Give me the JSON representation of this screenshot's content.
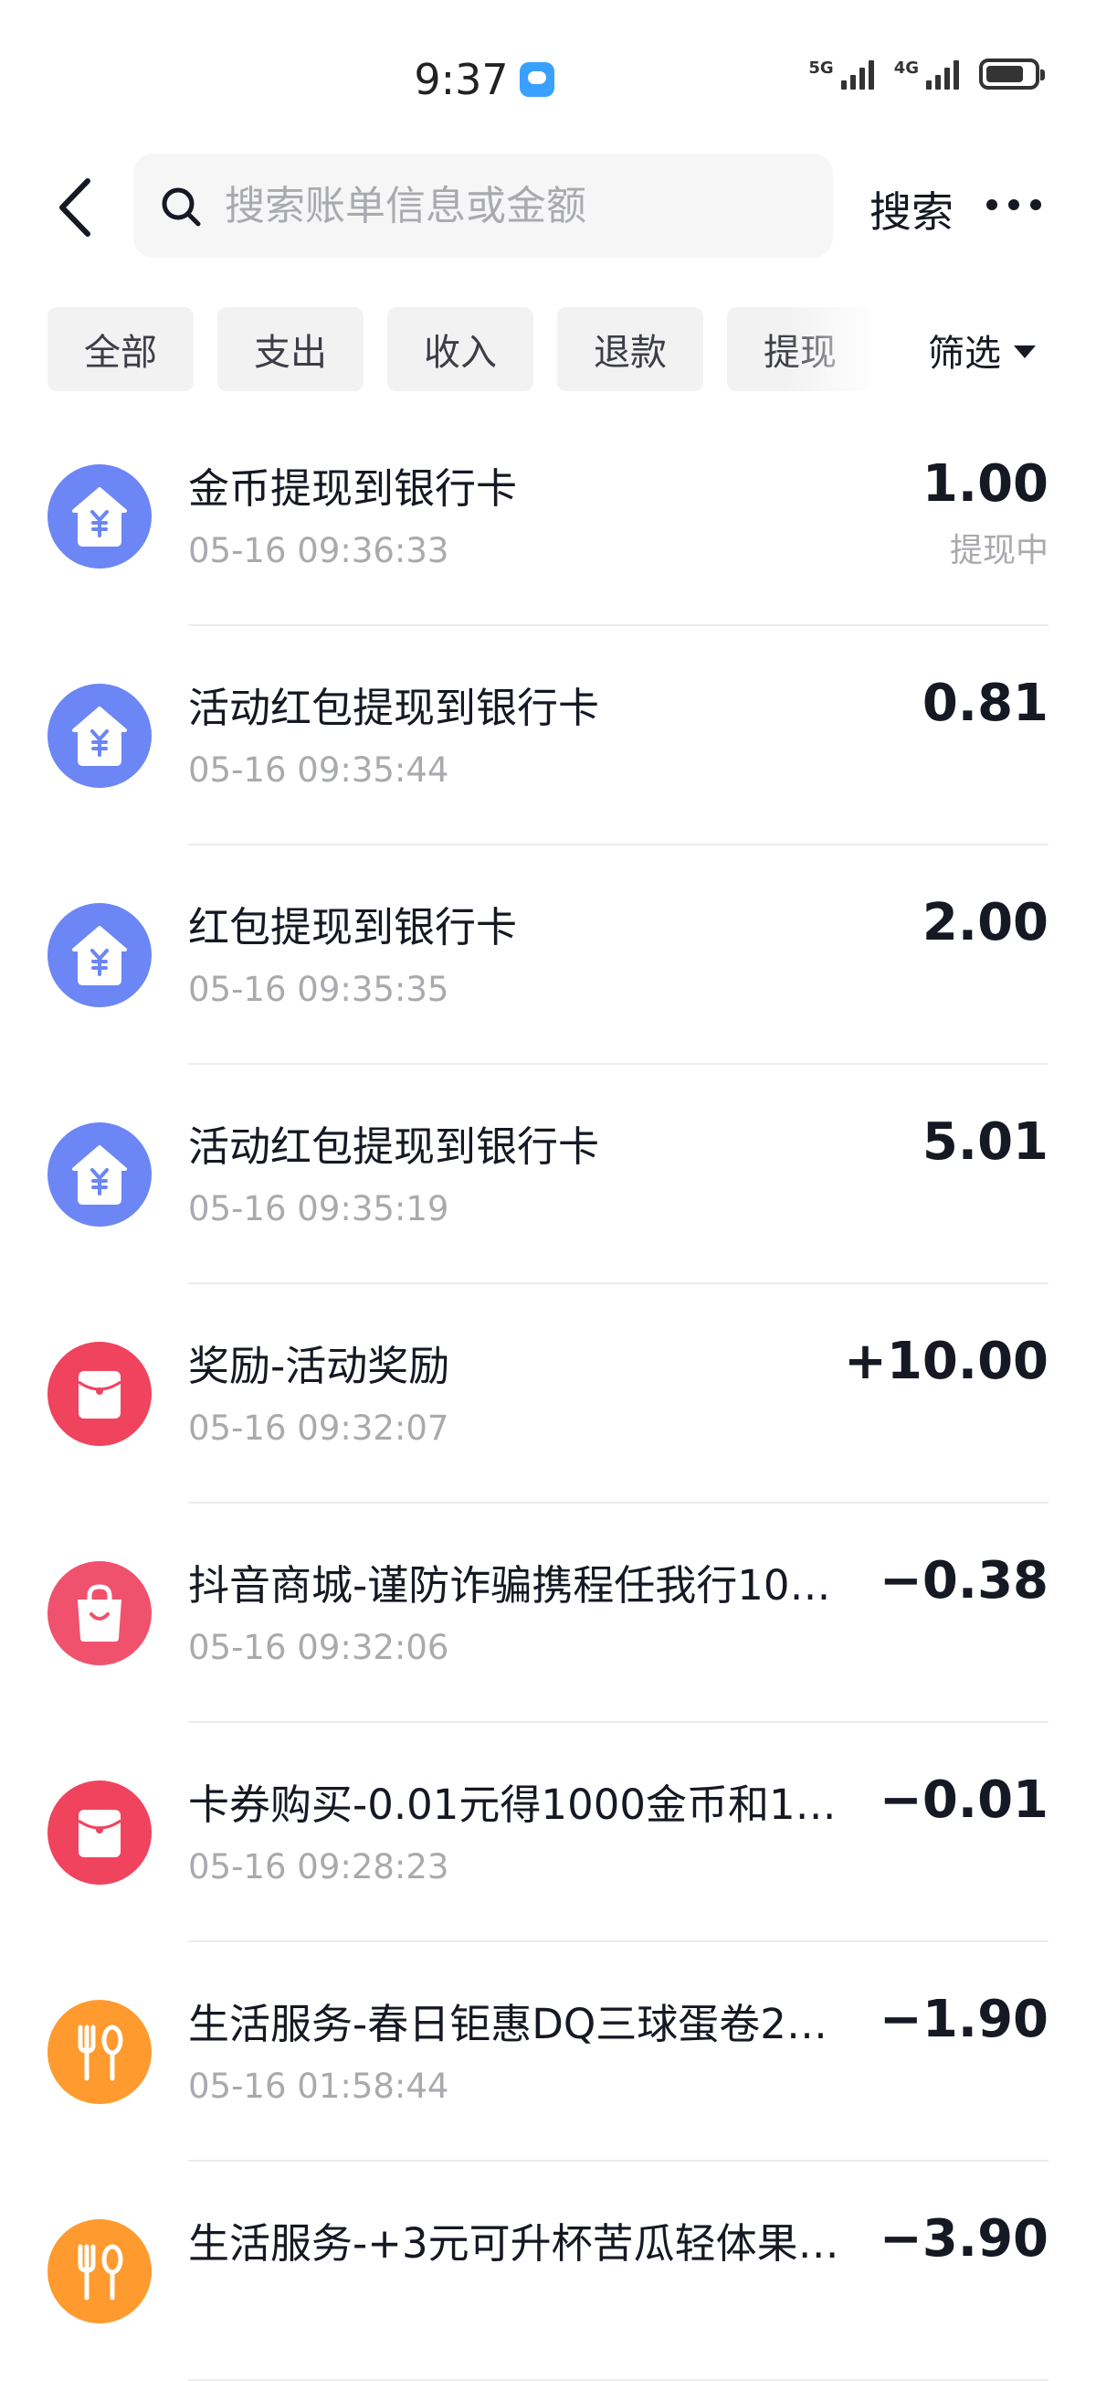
{
  "status_bar": {
    "time": "9:37",
    "network_1": "5G",
    "network_2": "4G"
  },
  "header": {
    "search_placeholder": "搜索账单信息或金额",
    "search_button_label": "搜索"
  },
  "filters": {
    "tabs": [
      "全部",
      "支出",
      "收入",
      "退款",
      "提现"
    ],
    "filter_label": "筛选"
  },
  "colors": {
    "withdraw_icon": "#6c86f5",
    "reward_icon": "#f0435e",
    "shopping_icon": "#f0526e",
    "service_icon": "#ff9a2e"
  },
  "transactions": [
    {
      "icon": "bank-withdraw-icon",
      "title": "金币提现到银行卡",
      "time": "05-16 09:36:33",
      "amount": "1.00",
      "status": "提现中"
    },
    {
      "icon": "bank-withdraw-icon",
      "title": "活动红包提现到银行卡",
      "time": "05-16 09:35:44",
      "amount": "0.81",
      "status": ""
    },
    {
      "icon": "bank-withdraw-icon",
      "title": "红包提现到银行卡",
      "time": "05-16 09:35:35",
      "amount": "2.00",
      "status": ""
    },
    {
      "icon": "bank-withdraw-icon",
      "title": "活动红包提现到银行卡",
      "time": "05-16 09:35:19",
      "amount": "5.01",
      "status": ""
    },
    {
      "icon": "red-envelope-icon",
      "title": "奖励-活动奖励",
      "time": "05-16 09:32:07",
      "amount": "+10.00",
      "status": ""
    },
    {
      "icon": "shopping-bag-icon",
      "title": "抖音商城-谨防诈骗携程任我行10…",
      "time": "05-16 09:32:06",
      "amount": "−0.38",
      "status": ""
    },
    {
      "icon": "red-envelope-icon",
      "title": "卡券购买-0.01元得1000金币和1…",
      "time": "05-16 09:28:23",
      "amount": "−0.01",
      "status": ""
    },
    {
      "icon": "fork-spoon-icon",
      "title": "生活服务-春日钜惠DQ三球蛋卷2…",
      "time": "05-16 01:58:44",
      "amount": "−1.90",
      "status": ""
    },
    {
      "icon": "fork-spoon-icon",
      "title": "生活服务-+3元可升杯苦瓜轻体果…",
      "time": "",
      "amount": "−3.90",
      "status": ""
    }
  ]
}
